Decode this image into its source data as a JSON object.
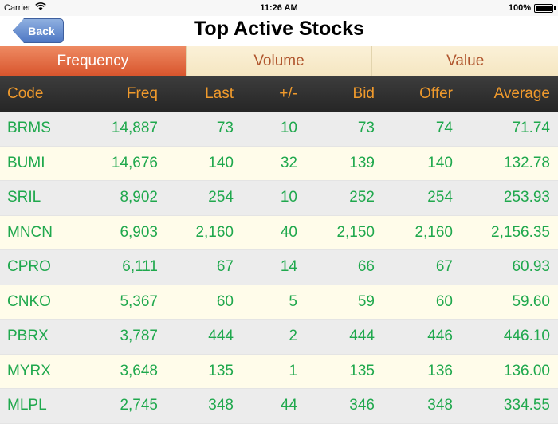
{
  "status_bar": {
    "carrier": "Carrier",
    "time": "11:26 AM",
    "battery": "100%"
  },
  "nav": {
    "back_label": "Back",
    "title": "Top Active Stocks"
  },
  "tabs": [
    {
      "label": "Frequency",
      "active": true
    },
    {
      "label": "Volume",
      "active": false
    },
    {
      "label": "Value",
      "active": false
    }
  ],
  "table": {
    "columns": [
      "Code",
      "Freq",
      "Last",
      "+/-",
      "Bid",
      "Offer",
      "Average"
    ],
    "rows": [
      [
        "BRMS",
        "14,887",
        "73",
        "10",
        "73",
        "74",
        "71.74"
      ],
      [
        "BUMI",
        "14,676",
        "140",
        "32",
        "139",
        "140",
        "132.78"
      ],
      [
        "SRIL",
        "8,902",
        "254",
        "10",
        "252",
        "254",
        "253.93"
      ],
      [
        "MNCN",
        "6,903",
        "2,160",
        "40",
        "2,150",
        "2,160",
        "2,156.35"
      ],
      [
        "CPRO",
        "6,111",
        "67",
        "14",
        "66",
        "67",
        "60.93"
      ],
      [
        "CNKO",
        "5,367",
        "60",
        "5",
        "59",
        "60",
        "59.60"
      ],
      [
        "PBRX",
        "3,787",
        "444",
        "2",
        "444",
        "446",
        "446.10"
      ],
      [
        "MYRX",
        "3,648",
        "135",
        "1",
        "135",
        "136",
        "136.00"
      ],
      [
        "MLPL",
        "2,745",
        "348",
        "44",
        "346",
        "348",
        "334.55"
      ]
    ]
  },
  "colors": {
    "header_text": "#f09a2c",
    "value_text": "#1fa84d",
    "tab_active": "#d8552d",
    "tab_inactive_text": "#b0562e"
  }
}
